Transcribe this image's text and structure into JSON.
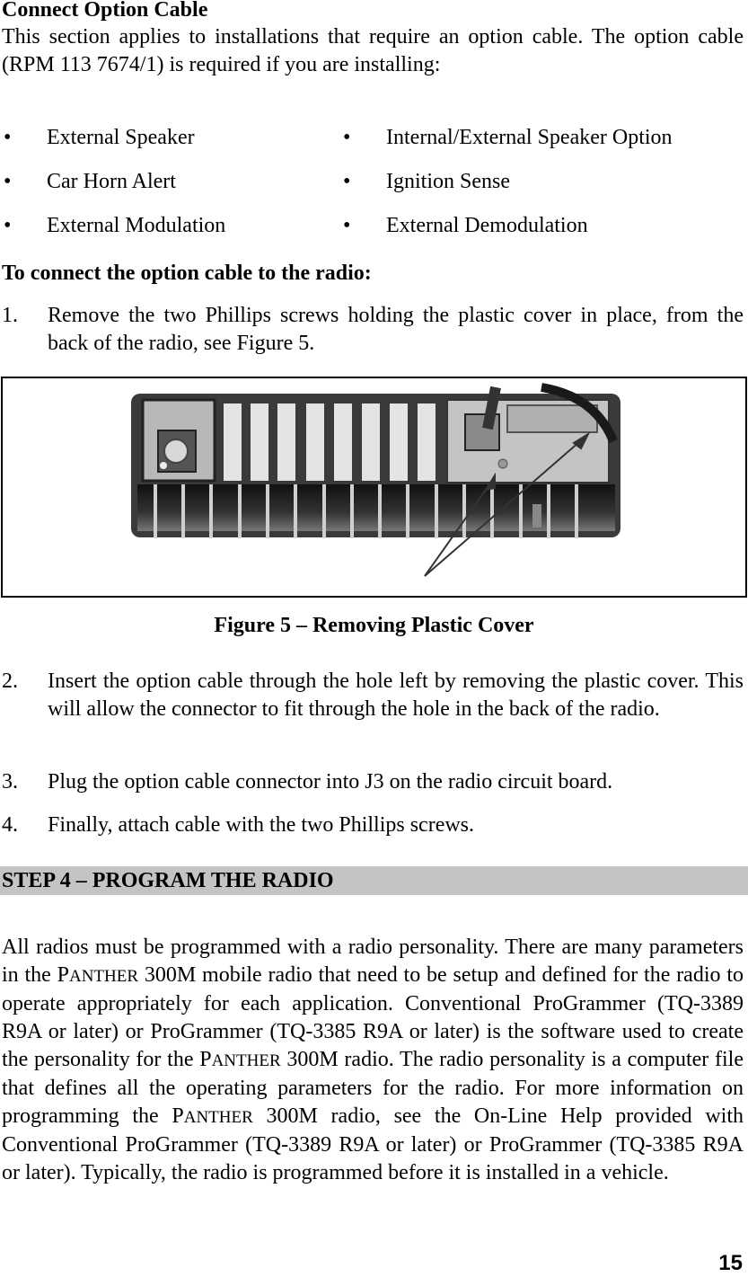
{
  "section": {
    "title": "Connect Option Cable",
    "intro": "This section applies to installations that require an option cable.  The option cable (RPM 113 7674/1) is required if you are installing:"
  },
  "bullets": {
    "left": [
      "External Speaker",
      "Car Horn Alert",
      "External Modulation"
    ],
    "right": [
      "Internal/External Speaker Option",
      "Ignition Sense",
      "External Demodulation"
    ],
    "glyph": "•"
  },
  "procedure": {
    "heading": "To connect the option cable to the radio:",
    "steps": [
      {
        "num": "1.",
        "text": "Remove the two Phillips screws holding the plastic cover in place, from the back of the radio, see Figure 5."
      },
      {
        "num": "2.",
        "text": "Insert the option cable through the hole left by removing the plastic cover.  This will allow the connector to fit through the hole in the back of the radio."
      },
      {
        "num": "3.",
        "text": "Plug the option cable connector into J3 on the radio circuit board."
      },
      {
        "num": "4.",
        "text": "Finally, attach cable with the two Phillips screws."
      }
    ]
  },
  "figure": {
    "caption": "Figure 5 – Removing Plastic Cover",
    "subject": "Rear view of radio heat sink with arrows pointing to two Phillips screws"
  },
  "step_header": {
    "label": "STEP 4 – PROGRAM THE RADIO",
    "bar_color": "#c4c4c4"
  },
  "program": {
    "p1": "All radios must be programmed with a radio personality.  There are many parameters in the ",
    "brand_p": "P",
    "brand_rest": "ANTHER",
    "p2": " 300M mobile radio that need to be setup and defined for the radio to operate appropriately for each application. Conventional ProGrammer (TQ-3389 R9A or later) or ProGrammer (TQ-3385 R9A or later) is the software used to create the personality for the ",
    "p3": " 300M radio.  The radio personality is a computer file that defines all the operating parameters for the radio.  For more information on programming the ",
    "p4": " 300M radio, see the On-Line Help provided with Conventional ProGrammer (TQ-3389 R9A or later) or ProGrammer (TQ-3385 R9A or later).  Typically, the radio is programmed before it is installed in a vehicle."
  },
  "page_number": "15"
}
